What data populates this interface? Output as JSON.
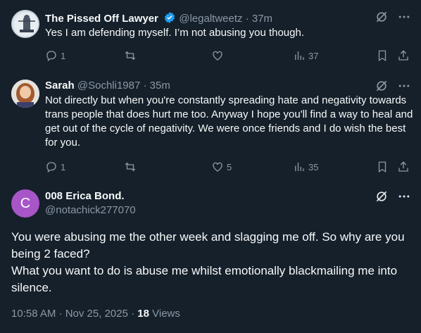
{
  "colors": {
    "background": "#15202b",
    "text": "#f7f9f9",
    "muted": "#8b98a5",
    "verified": "#1d9bf0",
    "avatar3": "#a855c7"
  },
  "tweets": [
    {
      "name": "The Pissed Off Lawyer",
      "handle": "@legaltweetz",
      "time": "· 37m",
      "text": "Yes I am defending myself. I’m not abusing you though.",
      "reply_count": "1",
      "retweet_count": "",
      "like_count": "",
      "view_count": "37",
      "verified": true
    },
    {
      "name": "Sarah",
      "handle": "@Sochli1987",
      "time": "· 35m",
      "text": "Not directly but when you're constantly spreading hate and negativity towards trans people that does hurt me too. Anyway I hope you'll find a way to heal and get out of the cycle of negativity. We were once friends and I do wish the best for you.",
      "reply_count": "1",
      "retweet_count": "",
      "like_count": "5",
      "view_count": "35"
    }
  ],
  "main_tweet": {
    "avatar_letter": "C",
    "name": "008 Erica Bond.",
    "handle": "@notachick277070",
    "text_line1": "You were abusing me the other week and slagging me off. So why are you being 2 faced?",
    "text_line2": "What you want to do is abuse me whilst emotionally blackmailing me into silence.",
    "timestamp": "10:58 AM · Nov 25, 2025 ·",
    "views_count": "18",
    "views_label": "Views"
  }
}
